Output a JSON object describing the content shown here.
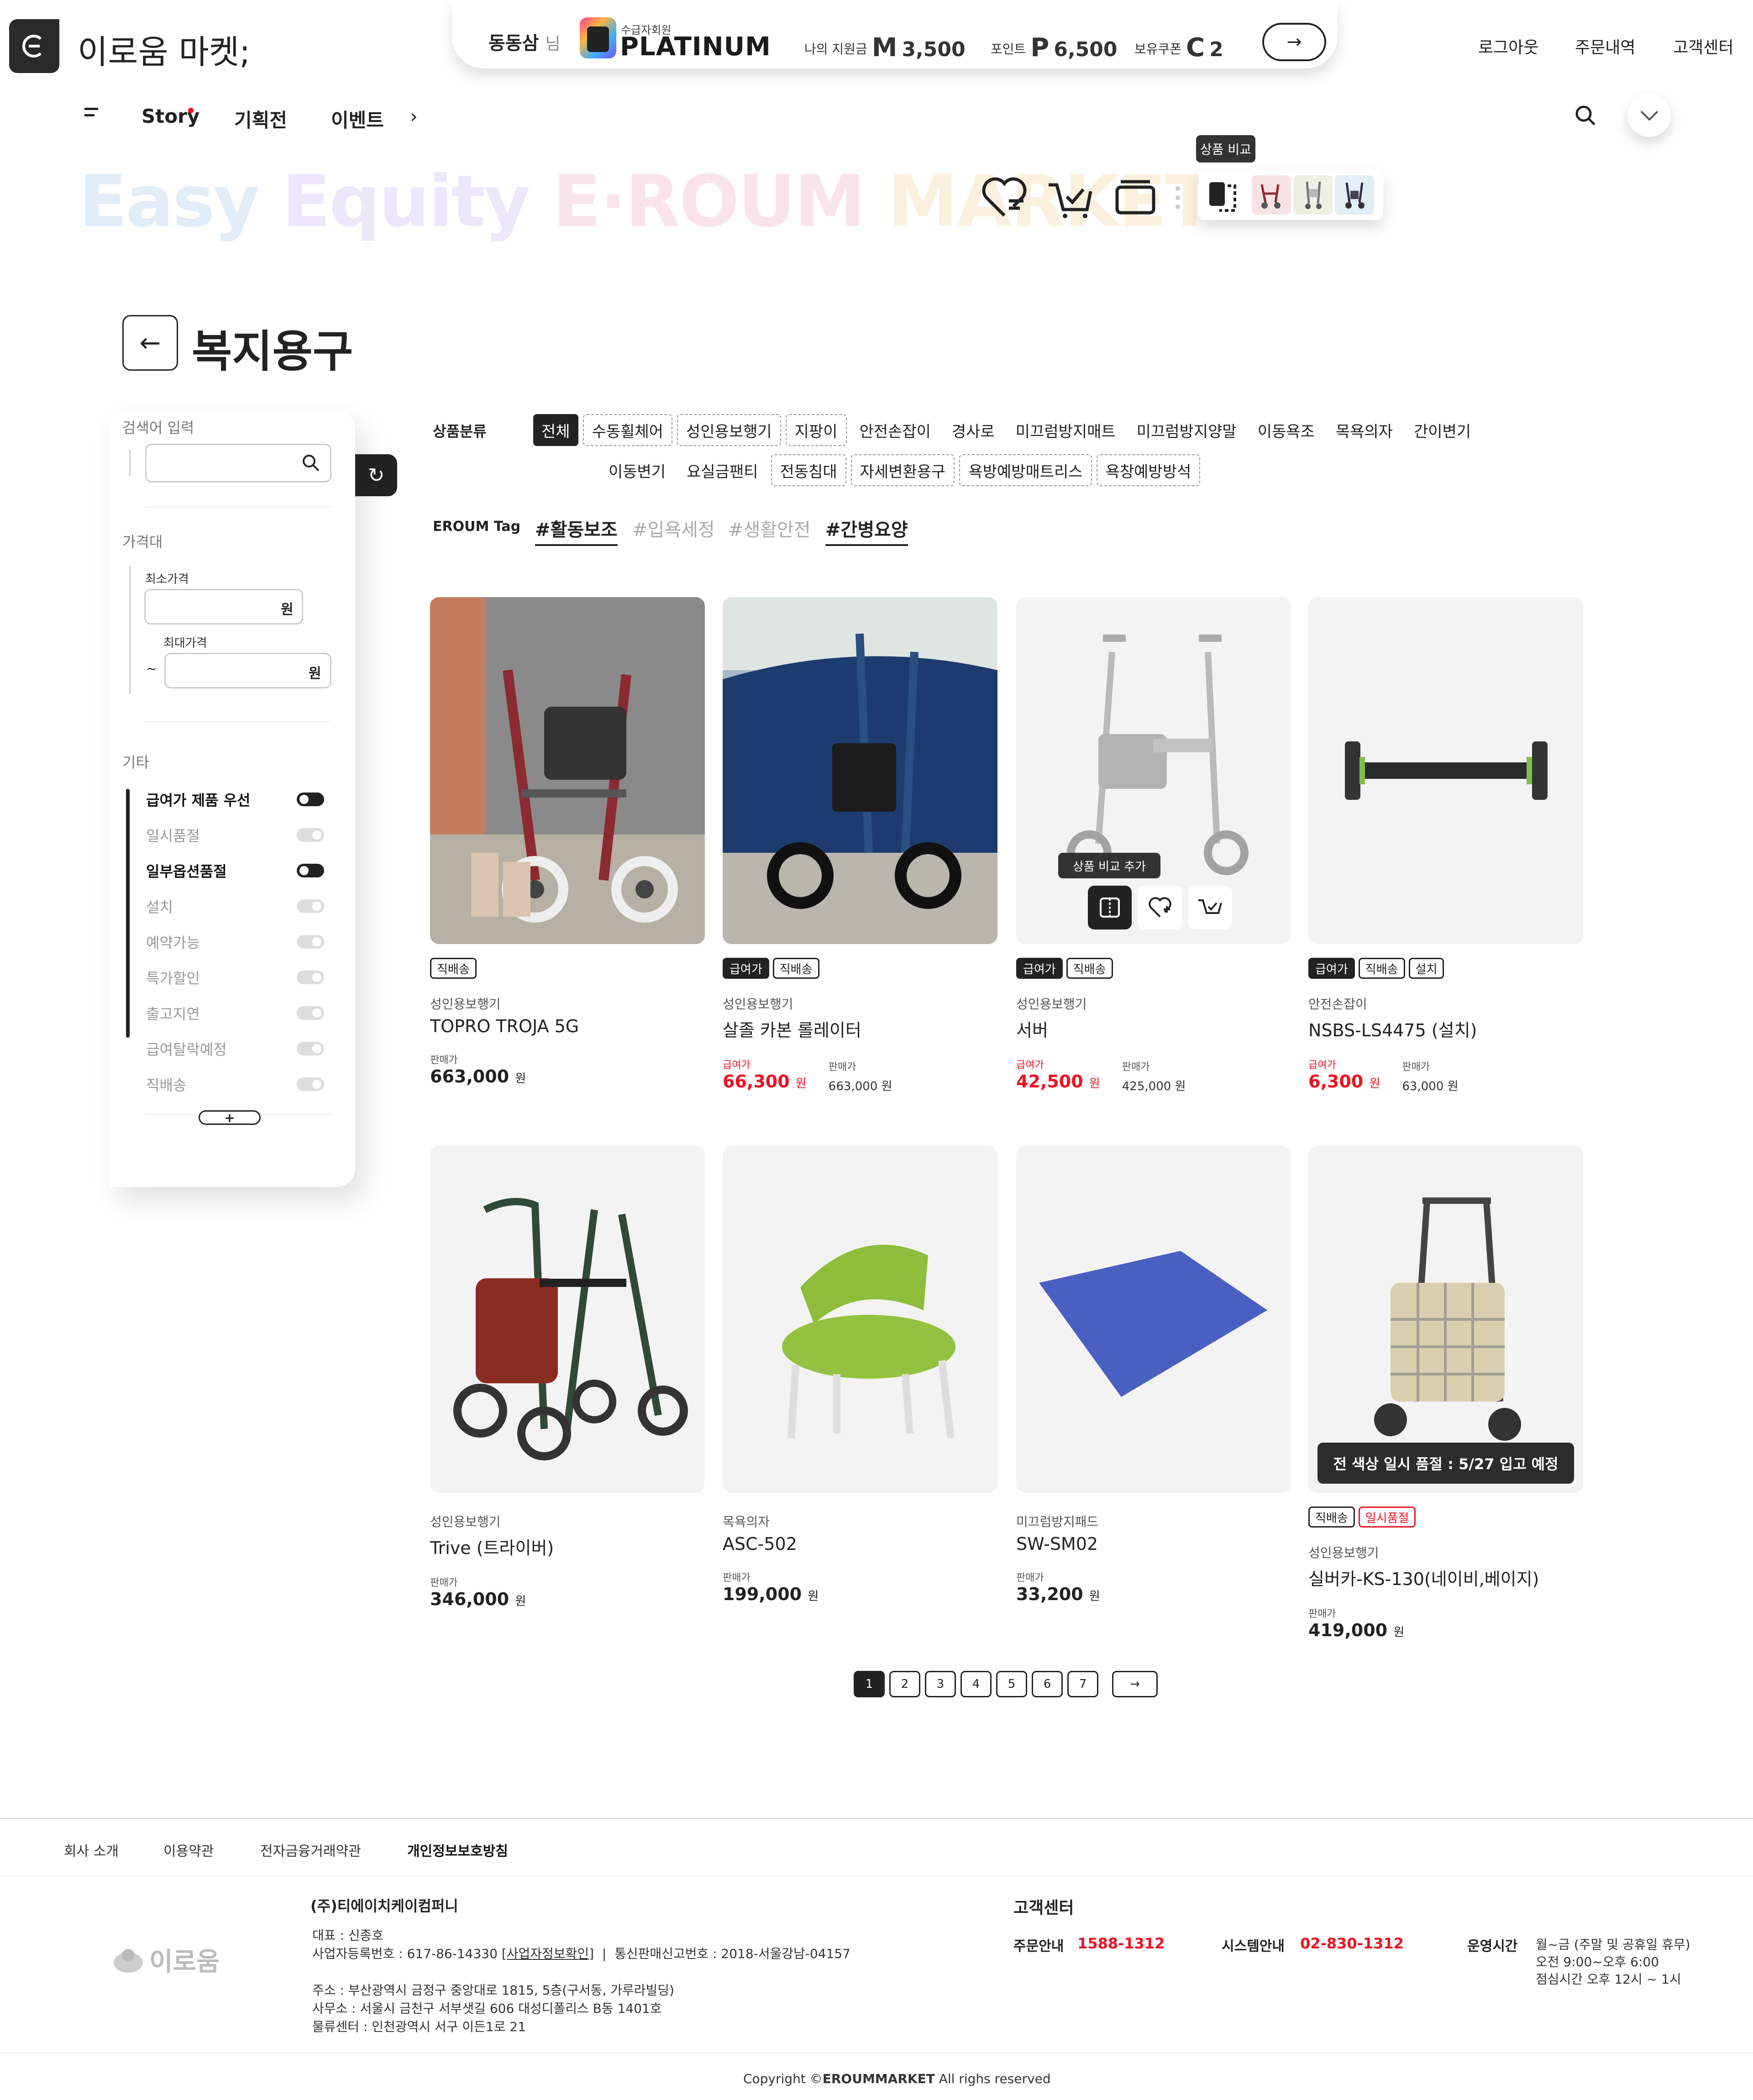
{
  "header": {
    "logo_text": "이로움 마켓;",
    "member_name": "동동삼",
    "member_suffix": "님",
    "grade_small": "수급자회원",
    "grade": "PLATINUM",
    "support_label": "나의 지원금",
    "support_icon": "M",
    "support_value": "3,500",
    "point_label": "포인트",
    "point_icon": "P",
    "point_value": "6,500",
    "coupon_label": "보유쿠폰",
    "coupon_icon": "C",
    "coupon_value": "2",
    "links": [
      "로그아웃",
      "주문내역",
      "고객센터"
    ]
  },
  "nav": {
    "items": [
      "Story",
      "기획전",
      "이벤트"
    ],
    "more": "›"
  },
  "hero": {
    "w1": "Easy",
    "w2": "Equity",
    "w3": "E·ROUM",
    "w4": "MARKET"
  },
  "compare": {
    "tooltip": "상품 비교"
  },
  "page": {
    "title": "복지용구"
  },
  "sidebar": {
    "search_label": "검색어 입력",
    "search_value": "",
    "price_label": "가격대",
    "min_label": "최소가격",
    "max_label": "최대가격",
    "currency": "원",
    "tilde": "~",
    "etc_label": "기타",
    "toggles": [
      {
        "label": "급여가 제품 우선",
        "on": true
      },
      {
        "label": "일시품절",
        "on": false
      },
      {
        "label": "일부옵션품절",
        "on": true
      },
      {
        "label": "설치",
        "on": false
      },
      {
        "label": "예약가능",
        "on": false
      },
      {
        "label": "특가할인",
        "on": false
      },
      {
        "label": "출고지연",
        "on": false
      },
      {
        "label": "급여탈락예정",
        "on": false
      },
      {
        "label": "직배송",
        "on": false
      }
    ],
    "more": "+"
  },
  "filters": {
    "category_label": "상품분류",
    "categories_row1": [
      "전체",
      "수동휠체어",
      "성인용보행기",
      "지팡이",
      "안전손잡이",
      "경사로",
      "미끄럼방지매트",
      "미끄럼방지양말",
      "이동욕조",
      "목욕의자",
      "간이변기"
    ],
    "categories_row2": [
      "이동변기",
      "요실금팬티",
      "전동침대",
      "자세변환용구",
      "욕방예방매트리스",
      "욕창예방방석"
    ],
    "tag_label": "EROUM Tag",
    "tags": [
      "#활동보조",
      "#입욕세정",
      "#생활안전",
      "#간병요양"
    ]
  },
  "products": [
    {
      "badges": [
        "직배송"
      ],
      "category": "성인용보행기",
      "name": "TOPRO TROJA 5G",
      "sale_label": "판매가",
      "sale_price": "663,000",
      "won": "원"
    },
    {
      "badges": [
        "급여가",
        "직배송"
      ],
      "category": "성인용보행기",
      "name": "살졸 카본 롤레이터",
      "benefit_label": "급여가",
      "benefit_price": "66,300",
      "sale_label": "판매가",
      "sale_price": "663,000 원",
      "won": "원"
    },
    {
      "badges": [
        "급여가",
        "직배송"
      ],
      "category": "성인용보행기",
      "name": "서버",
      "benefit_label": "급여가",
      "benefit_price": "42,500",
      "sale_label": "판매가",
      "sale_price": "425,000 원",
      "won": "원",
      "hover_tip": "상품 비교 추가"
    },
    {
      "badges": [
        "급여가",
        "직배송",
        "설치"
      ],
      "category": "안전손잡이",
      "name": "NSBS-LS4475 (설치)",
      "benefit_label": "급여가",
      "benefit_price": "6,300",
      "sale_label": "판매가",
      "sale_price": "63,000 원",
      "won": "원"
    },
    {
      "badges": [],
      "category": "성인용보행기",
      "name": "Trive (트라이버)",
      "sale_label": "판매가",
      "sale_price": "346,000",
      "won": "원"
    },
    {
      "badges": [],
      "category": "목욕의자",
      "name": "ASC-502",
      "sale_label": "판매가",
      "sale_price": "199,000",
      "won": "원"
    },
    {
      "badges": [],
      "category": "미끄럼방지패드",
      "name": "SW-SM02",
      "sale_label": "판매가",
      "sale_price": "33,200",
      "won": "원"
    },
    {
      "badges": [
        "직배송",
        "일시품절"
      ],
      "category": "성인용보행기",
      "name": "실버카-KS-130(네이비,베이지)",
      "sale_label": "판매가",
      "sale_price": "419,000",
      "won": "원",
      "soldout_banner": "전 색상 일시 품절 : 5/27 입고 예정"
    }
  ],
  "pagination": {
    "pages": [
      "1",
      "2",
      "3",
      "4",
      "5",
      "6",
      "7"
    ],
    "current": "1",
    "next": "→"
  },
  "footer": {
    "links": [
      "회사 소개",
      "이용약관",
      "전자금융거래약관",
      "개인정보보호방침"
    ],
    "logo": "이로움",
    "company": "(주)티에이치케이컴퍼니",
    "ceo": "대표 : 신종호",
    "biz": "사업자등록번호 : 617-86-14330",
    "biz_link": "[사업자정보확인]",
    "sep": "|",
    "mail_order": "통신판매신고번호 : 2018-서울강남-04157",
    "addr1": "주소 : 부산광역시 금정구 중앙대로 1815, 5층(구서동, 가루라빌딩)",
    "addr2": "사무소 : 서울시 금천구 서부샛길 606 대성디폴리스 B동 1401호",
    "addr3": "물류센터 : 인천광역시 서구 이든1로 21",
    "cs_title": "고객센터",
    "order_label": "주문안내",
    "order_phone": "1588-1312",
    "system_label": "시스템안내",
    "system_phone": "02-830-1312",
    "hours_label": "운영시간",
    "hours1": "월~금 (주말 및 공휴일 휴무)",
    "hours2": "오전 9:00~오후 6:00",
    "hours3": "점심시간 오후 12시 ~ 1시",
    "copyright_pre": "Copyright ©",
    "copyright_brand": "EROUMMARKET",
    "copyright_post": " All righs reserved"
  },
  "colors": {
    "accent": "#222222",
    "danger": "#e11122",
    "card_bg": "#f3f3f3"
  }
}
